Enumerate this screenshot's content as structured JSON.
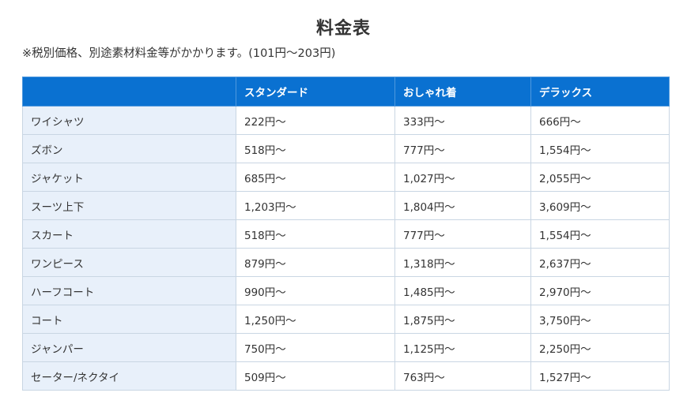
{
  "title": "料金表",
  "note": "※税別価格、別途素材料金等がかかります。(101円〜203円)",
  "table": {
    "headers": [
      "",
      "スタンダード",
      "おしゃれ着",
      "デラックス"
    ],
    "rows": [
      {
        "item": "ワイシャツ",
        "standard": "222円〜",
        "fashion": "333円〜",
        "deluxe": "666円〜"
      },
      {
        "item": "ズボン",
        "standard": "518円〜",
        "fashion": "777円〜",
        "deluxe": "1,554円〜"
      },
      {
        "item": "ジャケット",
        "standard": "685円〜",
        "fashion": "1,027円〜",
        "deluxe": "2,055円〜"
      },
      {
        "item": "スーツ上下",
        "standard": "1,203円〜",
        "fashion": "1,804円〜",
        "deluxe": "3,609円〜"
      },
      {
        "item": "スカート",
        "standard": "518円〜",
        "fashion": "777円〜",
        "deluxe": "1,554円〜"
      },
      {
        "item": "ワンピース",
        "standard": "879円〜",
        "fashion": "1,318円〜",
        "deluxe": "2,637円〜"
      },
      {
        "item": "ハーフコート",
        "standard": "990円〜",
        "fashion": "1,485円〜",
        "deluxe": "2,970円〜"
      },
      {
        "item": "コート",
        "standard": "1,250円〜",
        "fashion": "1,875円〜",
        "deluxe": "3,750円〜"
      },
      {
        "item": "ジャンパー",
        "standard": "750円〜",
        "fashion": "1,125円〜",
        "deluxe": "2,250円〜"
      },
      {
        "item": "セーター/ネクタイ",
        "standard": "509円〜",
        "fashion": "763円〜",
        "deluxe": "1,527円〜"
      }
    ]
  },
  "colors": {
    "header_bg": "#0a71d1",
    "item_col_bg": "#e8f0fa",
    "border": "#c9d6e3",
    "text": "#333333"
  }
}
